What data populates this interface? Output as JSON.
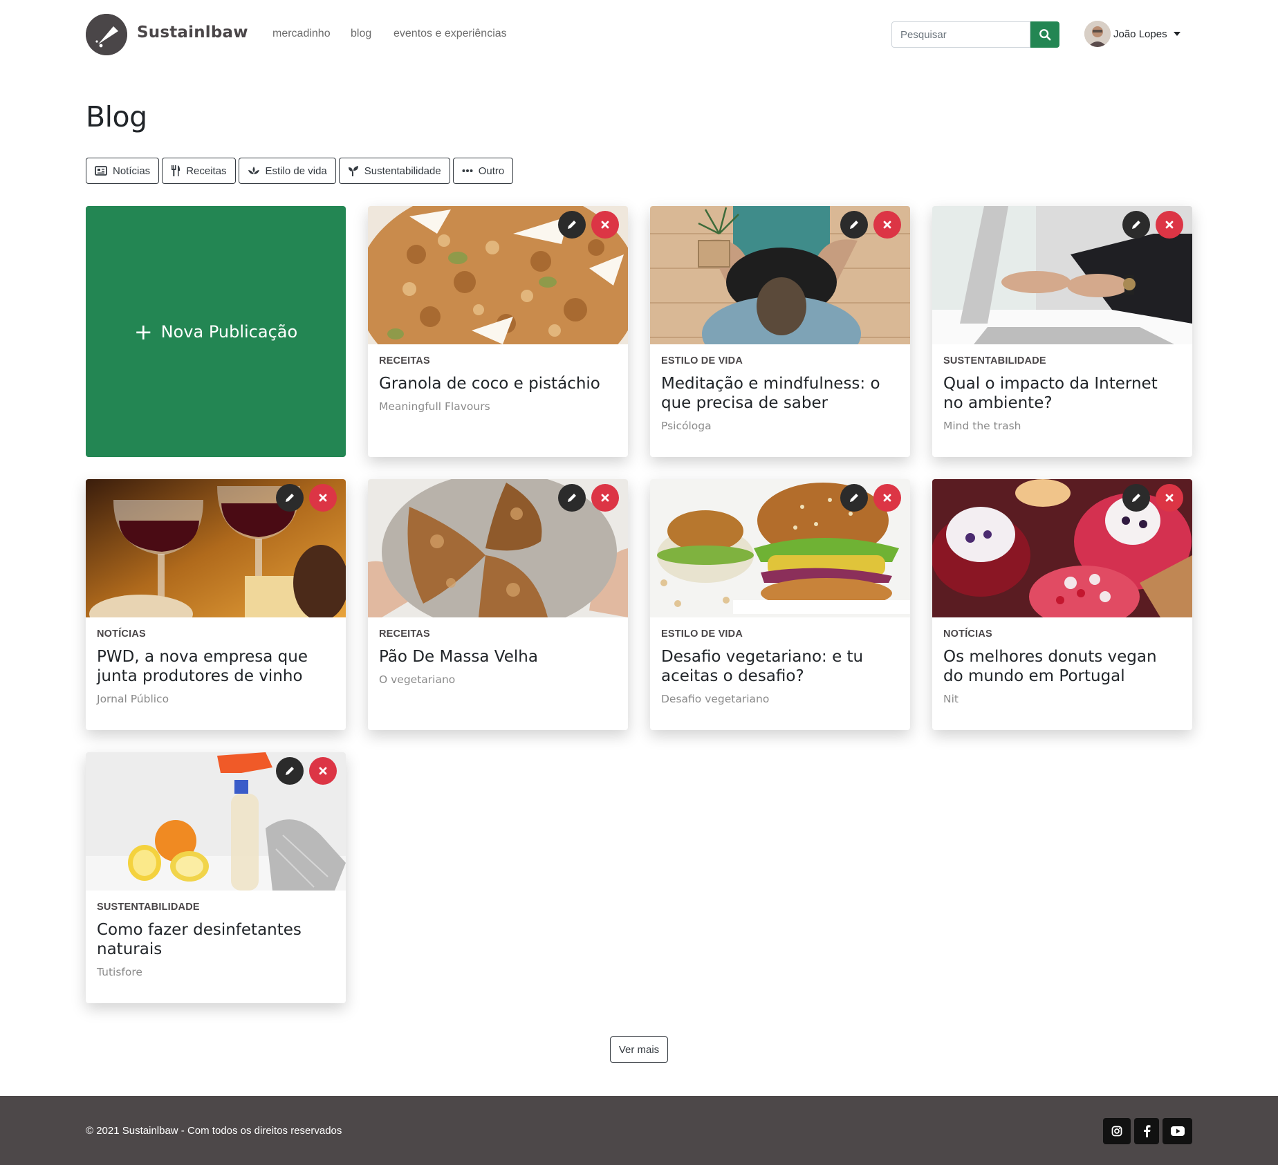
{
  "brand": {
    "name": "Sustainlbaw"
  },
  "nav": {
    "links": [
      "mercadinho",
      "blog",
      "eventos e experiências"
    ]
  },
  "search": {
    "placeholder": "Pesquisar"
  },
  "user": {
    "name": "João Lopes"
  },
  "page": {
    "title": "Blog"
  },
  "filters": [
    "Notícias",
    "Receitas",
    "Estilo de vida",
    "Sustentabilidade",
    "Outro"
  ],
  "new_post": {
    "label": "Nova Publicação"
  },
  "posts": [
    {
      "category": "RECEITAS",
      "title": "Granola de coco e pistáchio",
      "source": "Meaningfull Flavours",
      "image": "granola"
    },
    {
      "category": "ESTILO DE VIDA",
      "title": "Meditação e mindfulness: o que precisa de saber",
      "source": "Psicóloga",
      "image": "meditation"
    },
    {
      "category": "SUSTENTABILIDADE",
      "title": "Qual o impacto da Internet no ambiente?",
      "source": "Mind the trash",
      "image": "laptop"
    },
    {
      "category": "NOTÍCIAS",
      "title": "PWD, a nova empresa que junta produtores de vinho",
      "source": "Jornal Público",
      "image": "wine"
    },
    {
      "category": "RECEITAS",
      "title": "Pão De Massa Velha",
      "source": "O vegetariano",
      "image": "bread"
    },
    {
      "category": "ESTILO DE VIDA",
      "title": "Desafio vegetariano: e tu aceitas o desafio?",
      "source": "Desafio vegetariano",
      "image": "burger"
    },
    {
      "category": "NOTÍCIAS",
      "title": "Os melhores donuts vegan do mundo em Portugal",
      "source": "Nit",
      "image": "donuts"
    },
    {
      "category": "SUSTENTABILIDADE",
      "title": "Como fazer desinfetantes naturais",
      "source": "Tutisfore",
      "image": "cleaning"
    }
  ],
  "more": {
    "label": "Ver mais"
  },
  "footer": {
    "copyright": "© 2021 Sustainlbaw - Com todos os direitos reservados"
  },
  "social": [
    "instagram-icon",
    "facebook-icon",
    "youtube-icon"
  ],
  "colors": {
    "primary": "#238653",
    "danger": "#dc3545",
    "dark": "#2b2b2b",
    "footer": "#4d4849"
  }
}
